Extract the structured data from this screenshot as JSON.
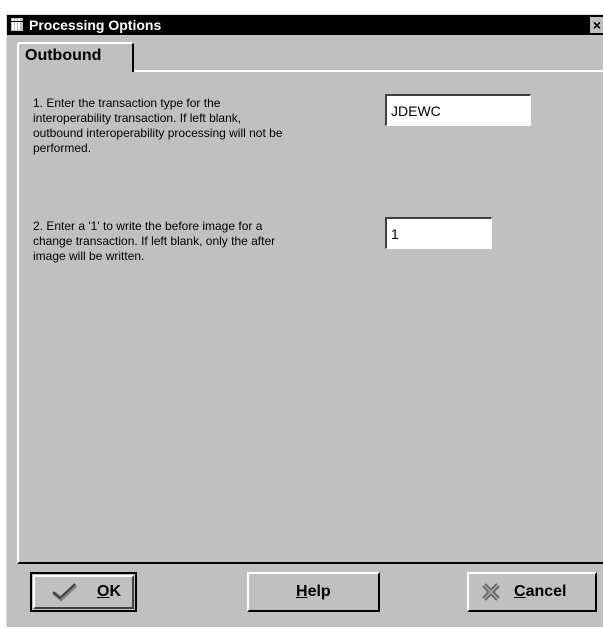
{
  "window": {
    "title": "Processing Options",
    "close_glyph": "×"
  },
  "tabs": [
    {
      "label": "Outbound"
    }
  ],
  "options": [
    {
      "prompt_lines": [
        "1. Enter the transaction type for the",
        "interoperability transaction. If left blank,",
        "outbound interoperability processing will not be",
        "performed."
      ],
      "value": "JDEWC"
    },
    {
      "prompt_lines": [
        "2. Enter a '1' to write the before image for a",
        "change transaction. If left blank, only the after",
        "image will be written."
      ],
      "value": "1"
    }
  ],
  "buttons": {
    "ok": {
      "label_mnemonic": "O",
      "label_rest": "K",
      "icon": "checkmark-icon"
    },
    "help": {
      "label_mnemonic": "H",
      "label_rest": "elp"
    },
    "cancel": {
      "label_mnemonic": "C",
      "label_rest": "ancel",
      "icon": "cancel-x-icon"
    }
  }
}
